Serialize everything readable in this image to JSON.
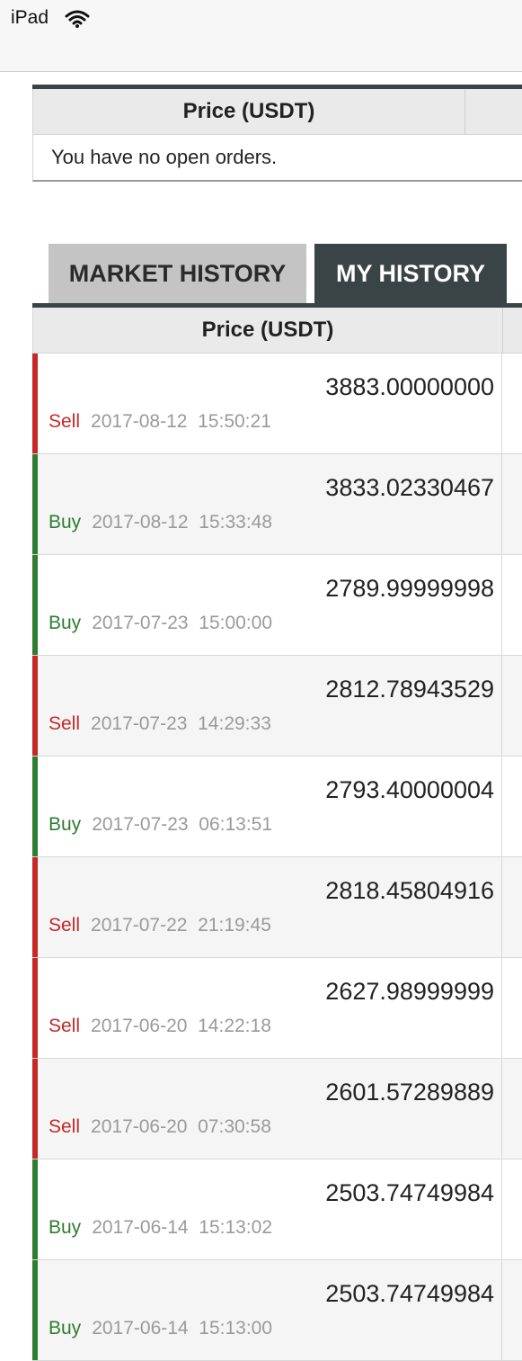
{
  "status_bar": {
    "device": "iPad",
    "wifi_icon": "wifi-icon"
  },
  "open_orders": {
    "column_header": "Price (USDT)",
    "empty_message": "You have no open orders."
  },
  "tabs": [
    {
      "label": "MARKET HISTORY",
      "active": false
    },
    {
      "label": "MY HISTORY",
      "active": true
    }
  ],
  "history": {
    "column_header": "Price (USDT)",
    "rows": [
      {
        "side": "Sell",
        "date": "2017-08-12",
        "time": "15:50:21",
        "price": "3883.00000000"
      },
      {
        "side": "Buy",
        "date": "2017-08-12",
        "time": "15:33:48",
        "price": "3833.02330467"
      },
      {
        "side": "Buy",
        "date": "2017-07-23",
        "time": "15:00:00",
        "price": "2789.99999998"
      },
      {
        "side": "Sell",
        "date": "2017-07-23",
        "time": "14:29:33",
        "price": "2812.78943529"
      },
      {
        "side": "Buy",
        "date": "2017-07-23",
        "time": "06:13:51",
        "price": "2793.40000004"
      },
      {
        "side": "Sell",
        "date": "2017-07-22",
        "time": "21:19:45",
        "price": "2818.45804916"
      },
      {
        "side": "Sell",
        "date": "2017-06-20",
        "time": "14:22:18",
        "price": "2627.98999999"
      },
      {
        "side": "Sell",
        "date": "2017-06-20",
        "time": "07:30:58",
        "price": "2601.57289889"
      },
      {
        "side": "Buy",
        "date": "2017-06-14",
        "time": "15:13:02",
        "price": "2503.74749984"
      },
      {
        "side": "Buy",
        "date": "2017-06-14",
        "time": "15:13:00",
        "price": "2503.74749984"
      }
    ]
  },
  "colors": {
    "sell": "#c62828",
    "buy": "#2e7d32",
    "tab_active_bg": "#3a4446",
    "tab_inactive_bg": "#c4c4c4"
  }
}
